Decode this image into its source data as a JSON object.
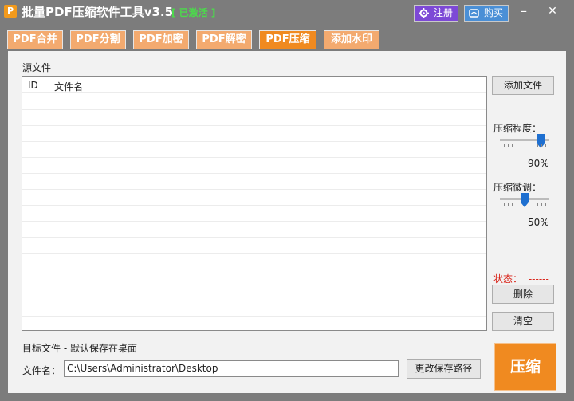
{
  "titlebar": {
    "app_icon": "P",
    "title": "批量PDF压缩软件工具v3.5",
    "status": "[ 已激活 ]",
    "register_label": "注册",
    "buy_label": "购买",
    "minimize": "–",
    "close": "✕"
  },
  "tabs": [
    {
      "label": "PDF合并",
      "active": false
    },
    {
      "label": "PDF分割",
      "active": false
    },
    {
      "label": "PDF加密",
      "active": false
    },
    {
      "label": "PDF解密",
      "active": false
    },
    {
      "label": "PDF压缩",
      "active": true
    },
    {
      "label": "添加水印",
      "active": false
    }
  ],
  "source": {
    "group_label": "源文件",
    "columns": [
      "ID",
      "文件名"
    ],
    "rows": []
  },
  "sidebar": {
    "add_file_label": "添加文件",
    "compression_level_label": "压缩程度：",
    "compression_level_value": "90%",
    "compression_level_fraction": 0.9,
    "fine_tune_label": "压缩微调：",
    "fine_tune_value": "50%",
    "fine_tune_fraction": 0.5,
    "status_label": "状态：",
    "status_value": "------",
    "delete_label": "删除",
    "clear_label": "清空"
  },
  "target": {
    "group_label": "目标文件 - 默认保存在桌面",
    "filename_label": "文件名：",
    "path_value": "C:\\Users\\Administrator\\Desktop",
    "change_path_label": "更改保存路径"
  },
  "compress_label": "压缩",
  "colors": {
    "accent": "#f08a20",
    "tab": "#f3aa6f",
    "register": "#7d49d6",
    "buy": "#4a8fd6",
    "status": "#d9261c",
    "activated": "#4cd94c"
  }
}
